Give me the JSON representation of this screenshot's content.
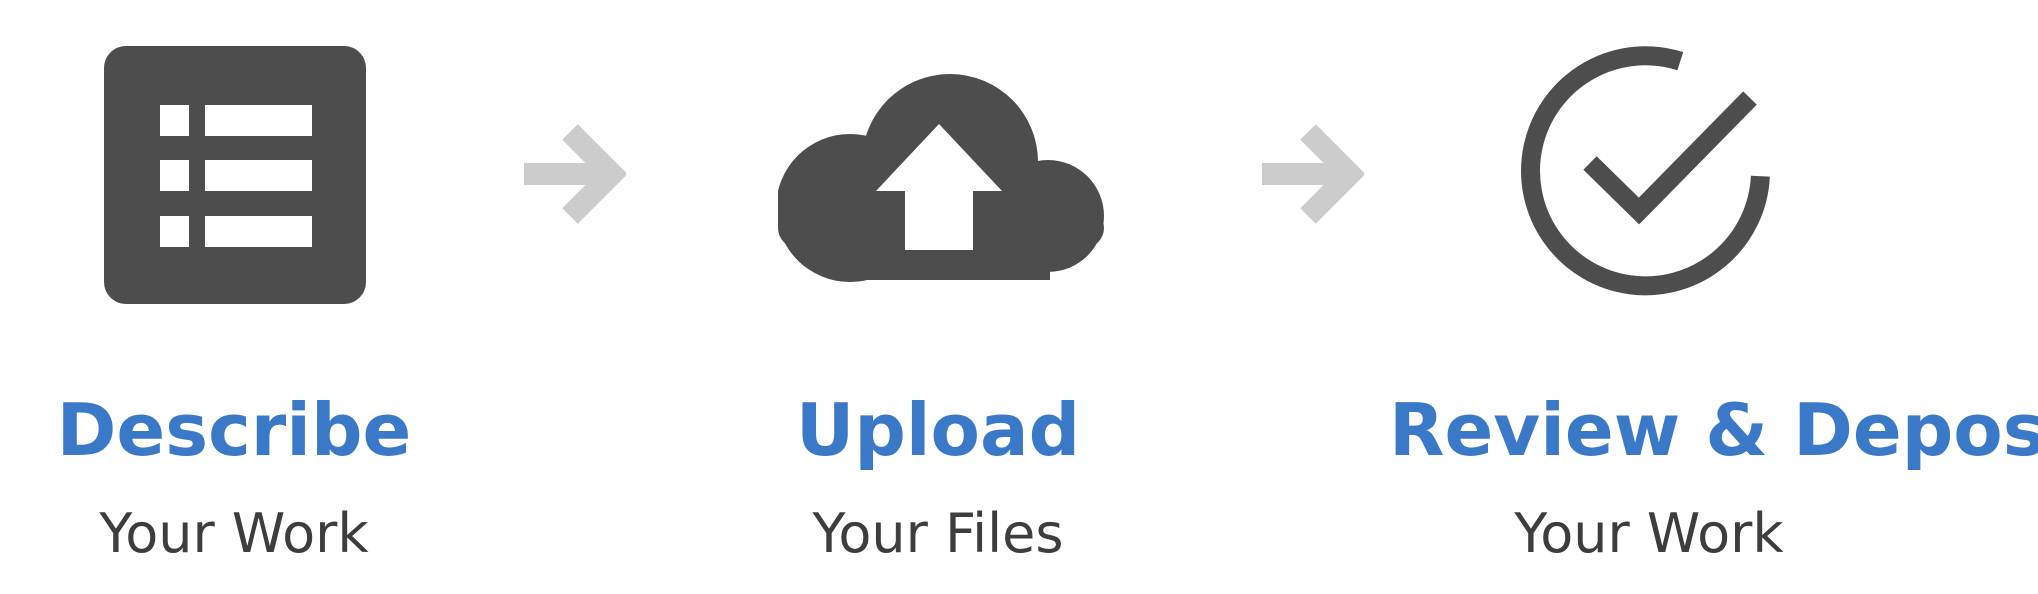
{
  "colors": {
    "icon": "#4d4d4d",
    "arrow": "#cccccc",
    "title": "#3a79c7",
    "subtitle": "#3d3d3d"
  },
  "steps": [
    {
      "icon": "list-icon",
      "title": "Describe",
      "subtitle": "Your Work"
    },
    {
      "icon": "cloud-upload-icon",
      "title": "Upload",
      "subtitle": "Your Files"
    },
    {
      "icon": "check-circle-icon",
      "title": "Review & Deposit",
      "subtitle": "Your Work"
    }
  ],
  "connectors": [
    "arrow-right-icon",
    "arrow-right-icon"
  ]
}
